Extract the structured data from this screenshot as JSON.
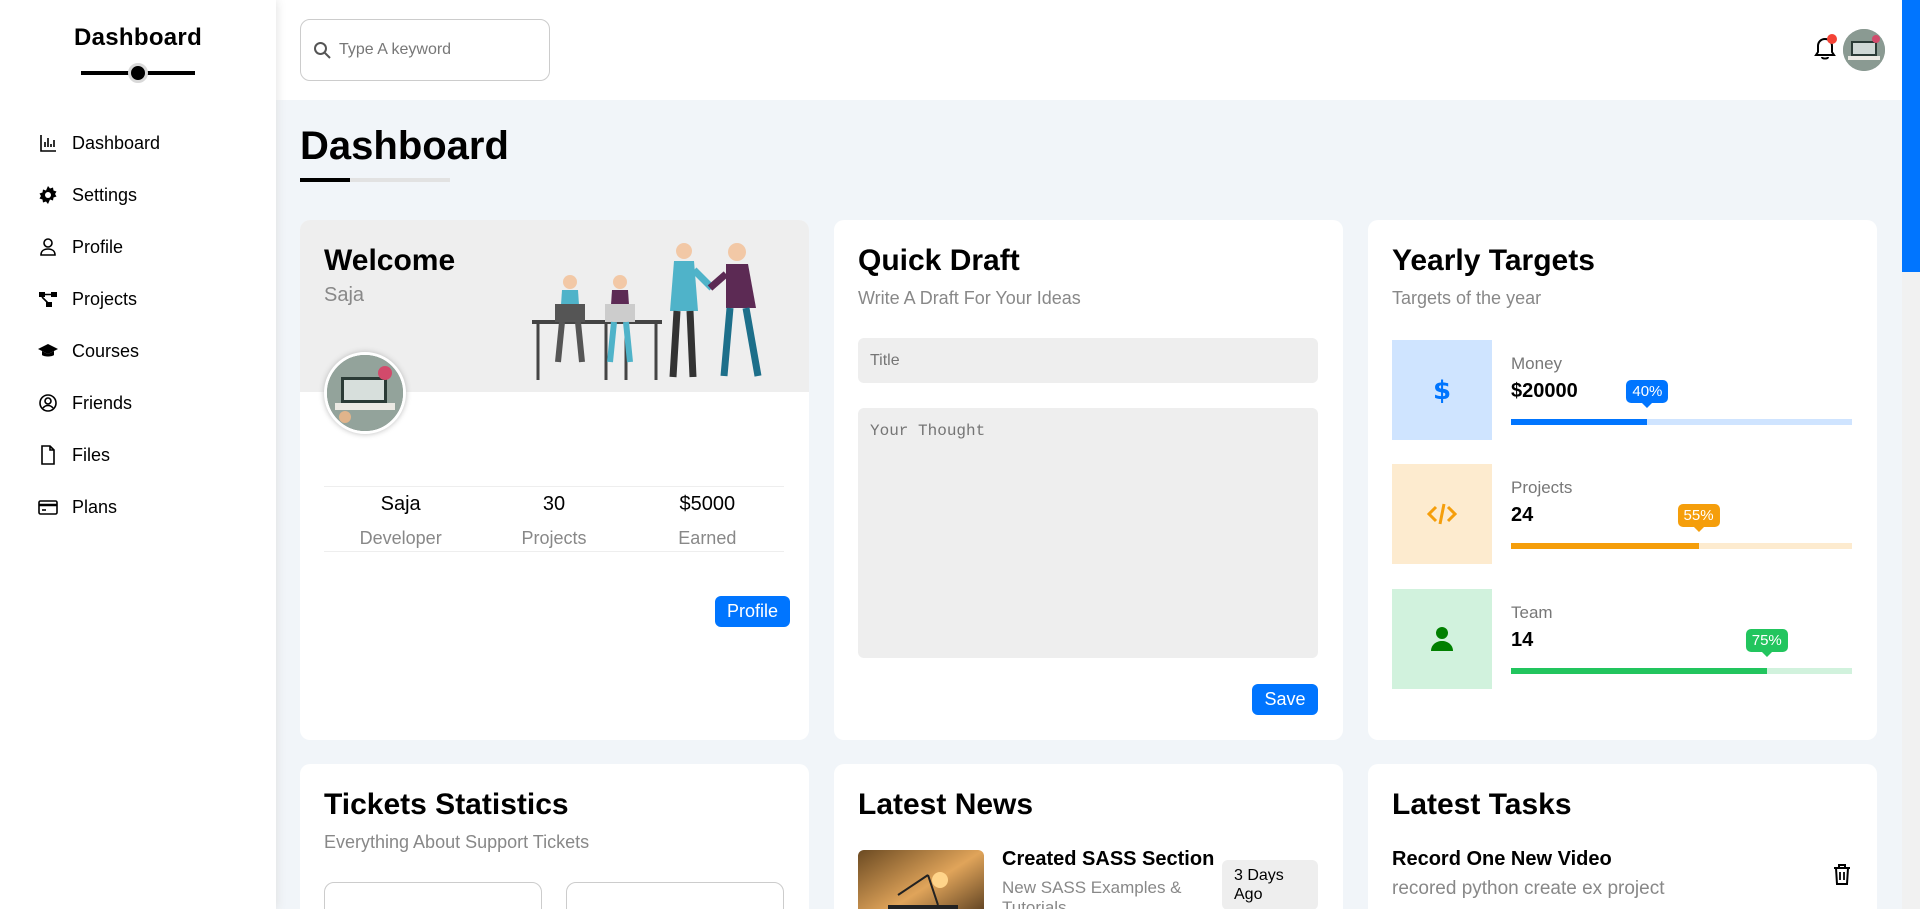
{
  "sidebar": {
    "brand": "Dashboard",
    "items": [
      {
        "label": "Dashboard",
        "icon": "chart-icon"
      },
      {
        "label": "Settings",
        "icon": "gear-icon"
      },
      {
        "label": "Profile",
        "icon": "user-icon"
      },
      {
        "label": "Projects",
        "icon": "diagram-icon"
      },
      {
        "label": "Courses",
        "icon": "graduation-cap-icon"
      },
      {
        "label": "Friends",
        "icon": "user-circle-icon"
      },
      {
        "label": "Files",
        "icon": "file-icon"
      },
      {
        "label": "Plans",
        "icon": "credit-card-icon"
      }
    ]
  },
  "header": {
    "search_placeholder": "Type A keyword",
    "notification_icon": "bell-icon"
  },
  "page": {
    "title": "Dashboard"
  },
  "welcome": {
    "title": "Welcome",
    "name": "Saja",
    "stats": [
      {
        "value": "Saja",
        "label": "Developer"
      },
      {
        "value": "30",
        "label": "Projects"
      },
      {
        "value": "$5000",
        "label": "Earned"
      }
    ],
    "button": "Profile"
  },
  "draft": {
    "title": "Quick Draft",
    "subtitle": "Write A Draft For Your Ideas",
    "title_placeholder": "Title",
    "thought_placeholder": "Your Thought",
    "button": "Save"
  },
  "targets": {
    "title": "Yearly Targets",
    "subtitle": "Targets of the year",
    "items": [
      {
        "label": "Money",
        "value": "$20000",
        "percent": 40,
        "percent_label": "40%",
        "color": "#0075ff",
        "light": "#cfe4ff",
        "icon": "dollar-icon"
      },
      {
        "label": "Projects",
        "value": "24",
        "percent": 55,
        "percent_label": "55%",
        "color": "#f59e0b",
        "light": "#fdebcf",
        "icon": "code-icon"
      },
      {
        "label": "Team",
        "value": "14",
        "percent": 75,
        "percent_label": "75%",
        "color": "#22c55e",
        "light": "#d1f2dd",
        "icon": "user-icon"
      }
    ]
  },
  "tickets": {
    "title": "Tickets Statistics",
    "subtitle": "Everything About Support Tickets"
  },
  "news": {
    "title": "Latest News",
    "item_title": "Created SASS Section",
    "item_desc": "New SASS Examples & Tutorials",
    "item_date": "3 Days Ago"
  },
  "tasks": {
    "title": "Latest Tasks",
    "item_title": "Record One New Video",
    "item_desc": "recored python create ex project"
  }
}
